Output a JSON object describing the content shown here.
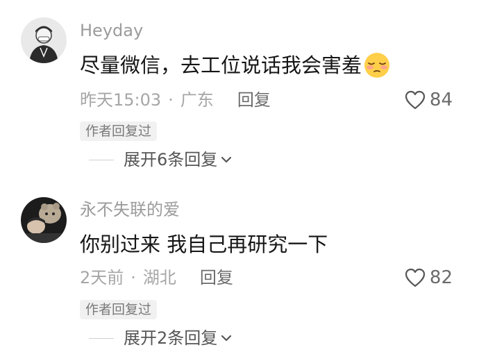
{
  "comments": [
    {
      "username": "Heyday",
      "text": "尽量微信，去工位说话我会害羞",
      "emoji": "shy-face-emoji",
      "time": "昨天15:03",
      "separator": "·",
      "location": "广东",
      "reply_label": "回复",
      "likes": "84",
      "author_badge": "作者回复过",
      "expand_label": "展开6条回复"
    },
    {
      "username": "永不失联的爱",
      "text": "你别过来 我自己再研究一下",
      "time": "2天前",
      "separator": "·",
      "location": "湖北",
      "reply_label": "回复",
      "likes": "82",
      "author_badge": "作者回复过",
      "expand_label": "展开2条回复"
    }
  ],
  "icons": {
    "like": "heart-outline-icon",
    "expand": "chevron-down-icon"
  },
  "colors": {
    "text_primary": "#161616",
    "text_secondary": "#9b9b9b",
    "badge_bg": "#f1f1f1"
  }
}
